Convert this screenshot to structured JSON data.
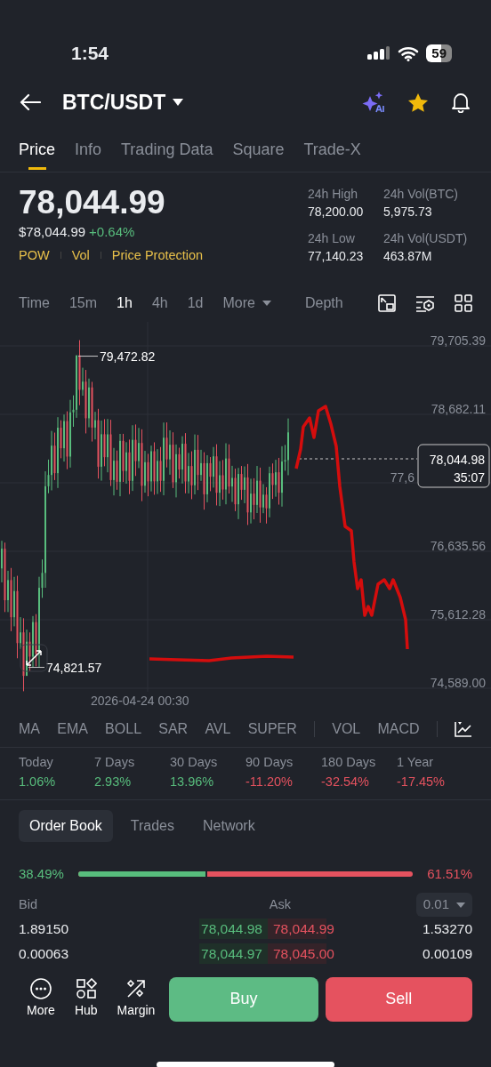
{
  "status_bar": {
    "time": "1:54",
    "battery": "59"
  },
  "header": {
    "title": "BTC/USDT"
  },
  "tabs": [
    {
      "label": "Price",
      "selected": true
    },
    {
      "label": "Info",
      "selected": false
    },
    {
      "label": "Trading Data",
      "selected": false
    },
    {
      "label": "Square",
      "selected": false
    },
    {
      "label": "Trade-X",
      "selected": false
    }
  ],
  "price": {
    "last": "78,044.99",
    "usd": "$78,044.99",
    "change": "+0.64%",
    "tags": [
      "POW",
      "Vol",
      "Price Protection"
    ]
  },
  "stats": [
    {
      "label": "24h High",
      "value": "78,200.00"
    },
    {
      "label": "24h Vol(BTC)",
      "value": "5,975.73"
    },
    {
      "label": "24h Low",
      "value": "77,140.23"
    },
    {
      "label": "24h Vol(USDT)",
      "value": "463.87M"
    }
  ],
  "chart_toolbar": {
    "intervals": [
      {
        "label": "Time",
        "selected": false
      },
      {
        "label": "15m",
        "selected": false
      },
      {
        "label": "1h",
        "selected": true
      },
      {
        "label": "4h",
        "selected": false
      },
      {
        "label": "1d",
        "selected": false
      }
    ],
    "more": "More",
    "depth": "Depth"
  },
  "chart": {
    "y_labels": [
      "79,705.39",
      "78,682.11",
      "77,6",
      "76,635.56",
      "75,612.28",
      "74,589.00"
    ],
    "high_label": "79,472.82",
    "low_label": "74,821.57",
    "last_price": "78,044.98",
    "countdown": "35:07",
    "date_label": "2026-04-24 00:30"
  },
  "indicator_groups": [
    [
      "MA",
      "EMA",
      "BOLL",
      "SAR",
      "AVL",
      "SUPER"
    ],
    [
      "VOL",
      "MACD"
    ]
  ],
  "performance": [
    {
      "label": "Today",
      "value": "1.06%",
      "color": "#58bd7d"
    },
    {
      "label": "7 Days",
      "value": "2.93%",
      "color": "#58bd7d"
    },
    {
      "label": "30 Days",
      "value": "13.96%",
      "color": "#58bd7d"
    },
    {
      "label": "90 Days",
      "value": "-11.20%",
      "color": "#e5525f"
    },
    {
      "label": "180 Days",
      "value": "-32.54%",
      "color": "#e5525f"
    },
    {
      "label": "1 Year",
      "value": "-17.45%",
      "color": "#e5525f"
    }
  ],
  "order_book": {
    "tabs": [
      {
        "label": "Order Book",
        "selected": true
      },
      {
        "label": "Trades",
        "selected": false
      },
      {
        "label": "Network",
        "selected": false
      }
    ],
    "bid_pct": "38.49%",
    "ask_pct": "61.51%",
    "level": 0.3849,
    "bid_header": "Bid",
    "ask_header": "Ask",
    "precision": "0.01",
    "rows": [
      {
        "bid_qty": "1.89150",
        "bid_price": "78,044.98",
        "ask_price": "78,044.99",
        "ask_qty": "1.53270"
      },
      {
        "bid_qty": "0.00063",
        "bid_price": "78,044.97",
        "ask_price": "78,045.00",
        "ask_qty": "0.00109"
      }
    ]
  },
  "bottom": {
    "actions": [
      {
        "label": "More",
        "kind": "more"
      },
      {
        "label": "Hub",
        "kind": "hub"
      },
      {
        "label": "Margin",
        "kind": "margin"
      }
    ],
    "buy": "Buy",
    "sell": "Sell"
  }
}
